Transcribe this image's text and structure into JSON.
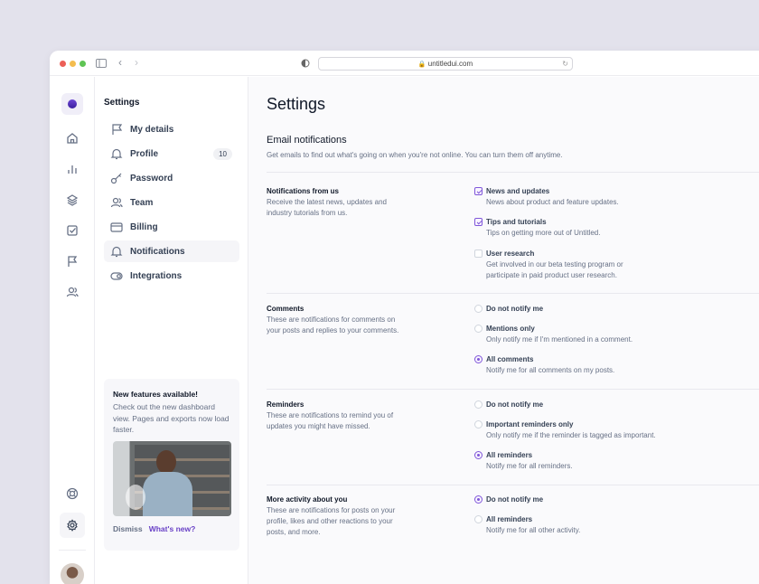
{
  "browser": {
    "url": "untitledui.com"
  },
  "nav": {
    "title": "Settings",
    "items": [
      {
        "label": "My details",
        "icon": "flag-icon"
      },
      {
        "label": "Profile",
        "icon": "bell-icon",
        "badge": "10"
      },
      {
        "label": "Password",
        "icon": "key-icon"
      },
      {
        "label": "Team",
        "icon": "users-icon"
      },
      {
        "label": "Billing",
        "icon": "credit-card-icon"
      },
      {
        "label": "Notifications",
        "icon": "bell-icon",
        "active": true
      },
      {
        "label": "Integrations",
        "icon": "toggle-icon"
      }
    ],
    "card": {
      "title": "New features available!",
      "text": "Check out the new dashboard view. Pages and exports now load faster.",
      "dismiss": "Dismiss",
      "whats_new": "What's new?"
    }
  },
  "main": {
    "title": "Settings",
    "section_title": "Email notifications",
    "section_desc": "Get emails to find out what's going on when you're not online. You can turn them off anytime.",
    "groups": [
      {
        "title": "Notifications from us",
        "desc": "Receive the latest news, updates and industry tutorials from us.",
        "options": [
          {
            "label": "News and updates",
            "desc": "News about product and feature updates.",
            "checked": true
          },
          {
            "label": "Tips and tutorials",
            "desc": "Tips on getting more out of Untitled.",
            "checked": true
          },
          {
            "label": "User research",
            "desc": "Get involved in our beta testing program or participate in paid product user research.",
            "checked": false
          }
        ]
      },
      {
        "title": "Comments",
        "desc": "These are notifications for comments on your posts and replies to your comments.",
        "options": [
          {
            "label": "Do not notify me",
            "desc": ""
          },
          {
            "label": "Mentions only",
            "desc": "Only notify me if I'm mentioned in a comment."
          },
          {
            "label": "All comments",
            "desc": "Notify me for all comments on my posts.",
            "selected": true
          }
        ]
      },
      {
        "title": "Reminders",
        "desc": "These are notifications to remind you of updates you might have missed.",
        "options": [
          {
            "label": "Do not notify me",
            "desc": ""
          },
          {
            "label": "Important reminders only",
            "desc": "Only notify me if the reminder is tagged as important."
          },
          {
            "label": "All reminders",
            "desc": "Notify me for all reminders.",
            "selected": true
          }
        ]
      },
      {
        "title": "More activity about you",
        "desc": "These are notifications for posts on your profile, likes and other reactions to your posts, and more.",
        "options": [
          {
            "label": "Do not notify me",
            "desc": "",
            "selected": true
          },
          {
            "label": "All reminders",
            "desc": "Notify me for all other activity."
          }
        ]
      }
    ]
  },
  "colors": {
    "accent": "#7f56d9",
    "background": "#e3e2ec"
  }
}
